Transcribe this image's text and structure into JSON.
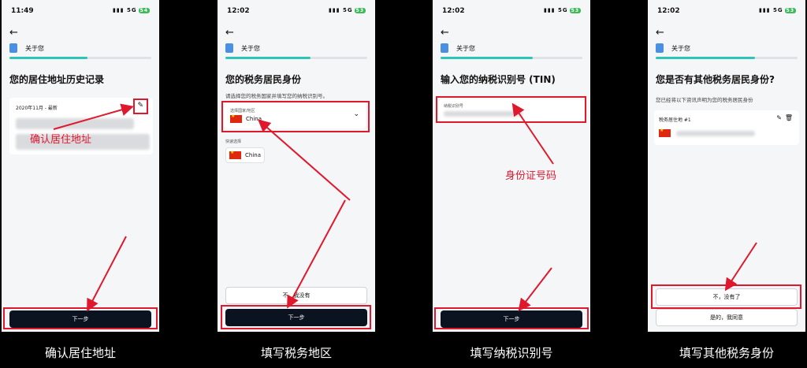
{
  "screens": [
    {
      "status": {
        "time": "11:49",
        "signal": "5G",
        "battery": "54"
      },
      "section_label": "关于您",
      "progress": 0.55,
      "title": "您的居住地址历史记录",
      "card_header": "2020年11月 - 最新",
      "annotation": "确认居住地址",
      "primary_button": "下一步",
      "caption": "确认居住地址"
    },
    {
      "status": {
        "time": "12:02",
        "signal": "5G",
        "battery": "53"
      },
      "section_label": "关于您",
      "progress": 0.6,
      "title": "您的税务居民身份",
      "subtitle": "请选择您的税务国家并填写您的纳税识别号。",
      "select_label": "选择国家/地区",
      "select_value": "China",
      "quick_label": "快速选择",
      "quick_option": "China",
      "secondary_button": "不，我没有",
      "primary_button": "下一步",
      "caption": "填写税务地区"
    },
    {
      "status": {
        "time": "12:02",
        "signal": "5G",
        "battery": "53"
      },
      "section_label": "关于您",
      "progress": 0.65,
      "title": "输入您的纳税识别号 (TIN)",
      "input_label": "纳税识别号",
      "annotation": "身份证号码",
      "primary_button": "下一步",
      "caption": "填写纳税识别号"
    },
    {
      "status": {
        "time": "12:02",
        "signal": "5G",
        "battery": "53"
      },
      "section_label": "关于您",
      "progress": 0.7,
      "title": "您是否有其他税务居民身份?",
      "subtitle": "您已经将以下资讯声明为您的税务居民身份",
      "card_header": "税务居住地 #1",
      "option_no": "不，没有了",
      "option_yes": "是的，我同意",
      "caption": "填写其他税务身份"
    }
  ],
  "colors": {
    "accent": "#2fc4b8",
    "annotation": "#e0182d",
    "button_dark": "#0b1220"
  }
}
